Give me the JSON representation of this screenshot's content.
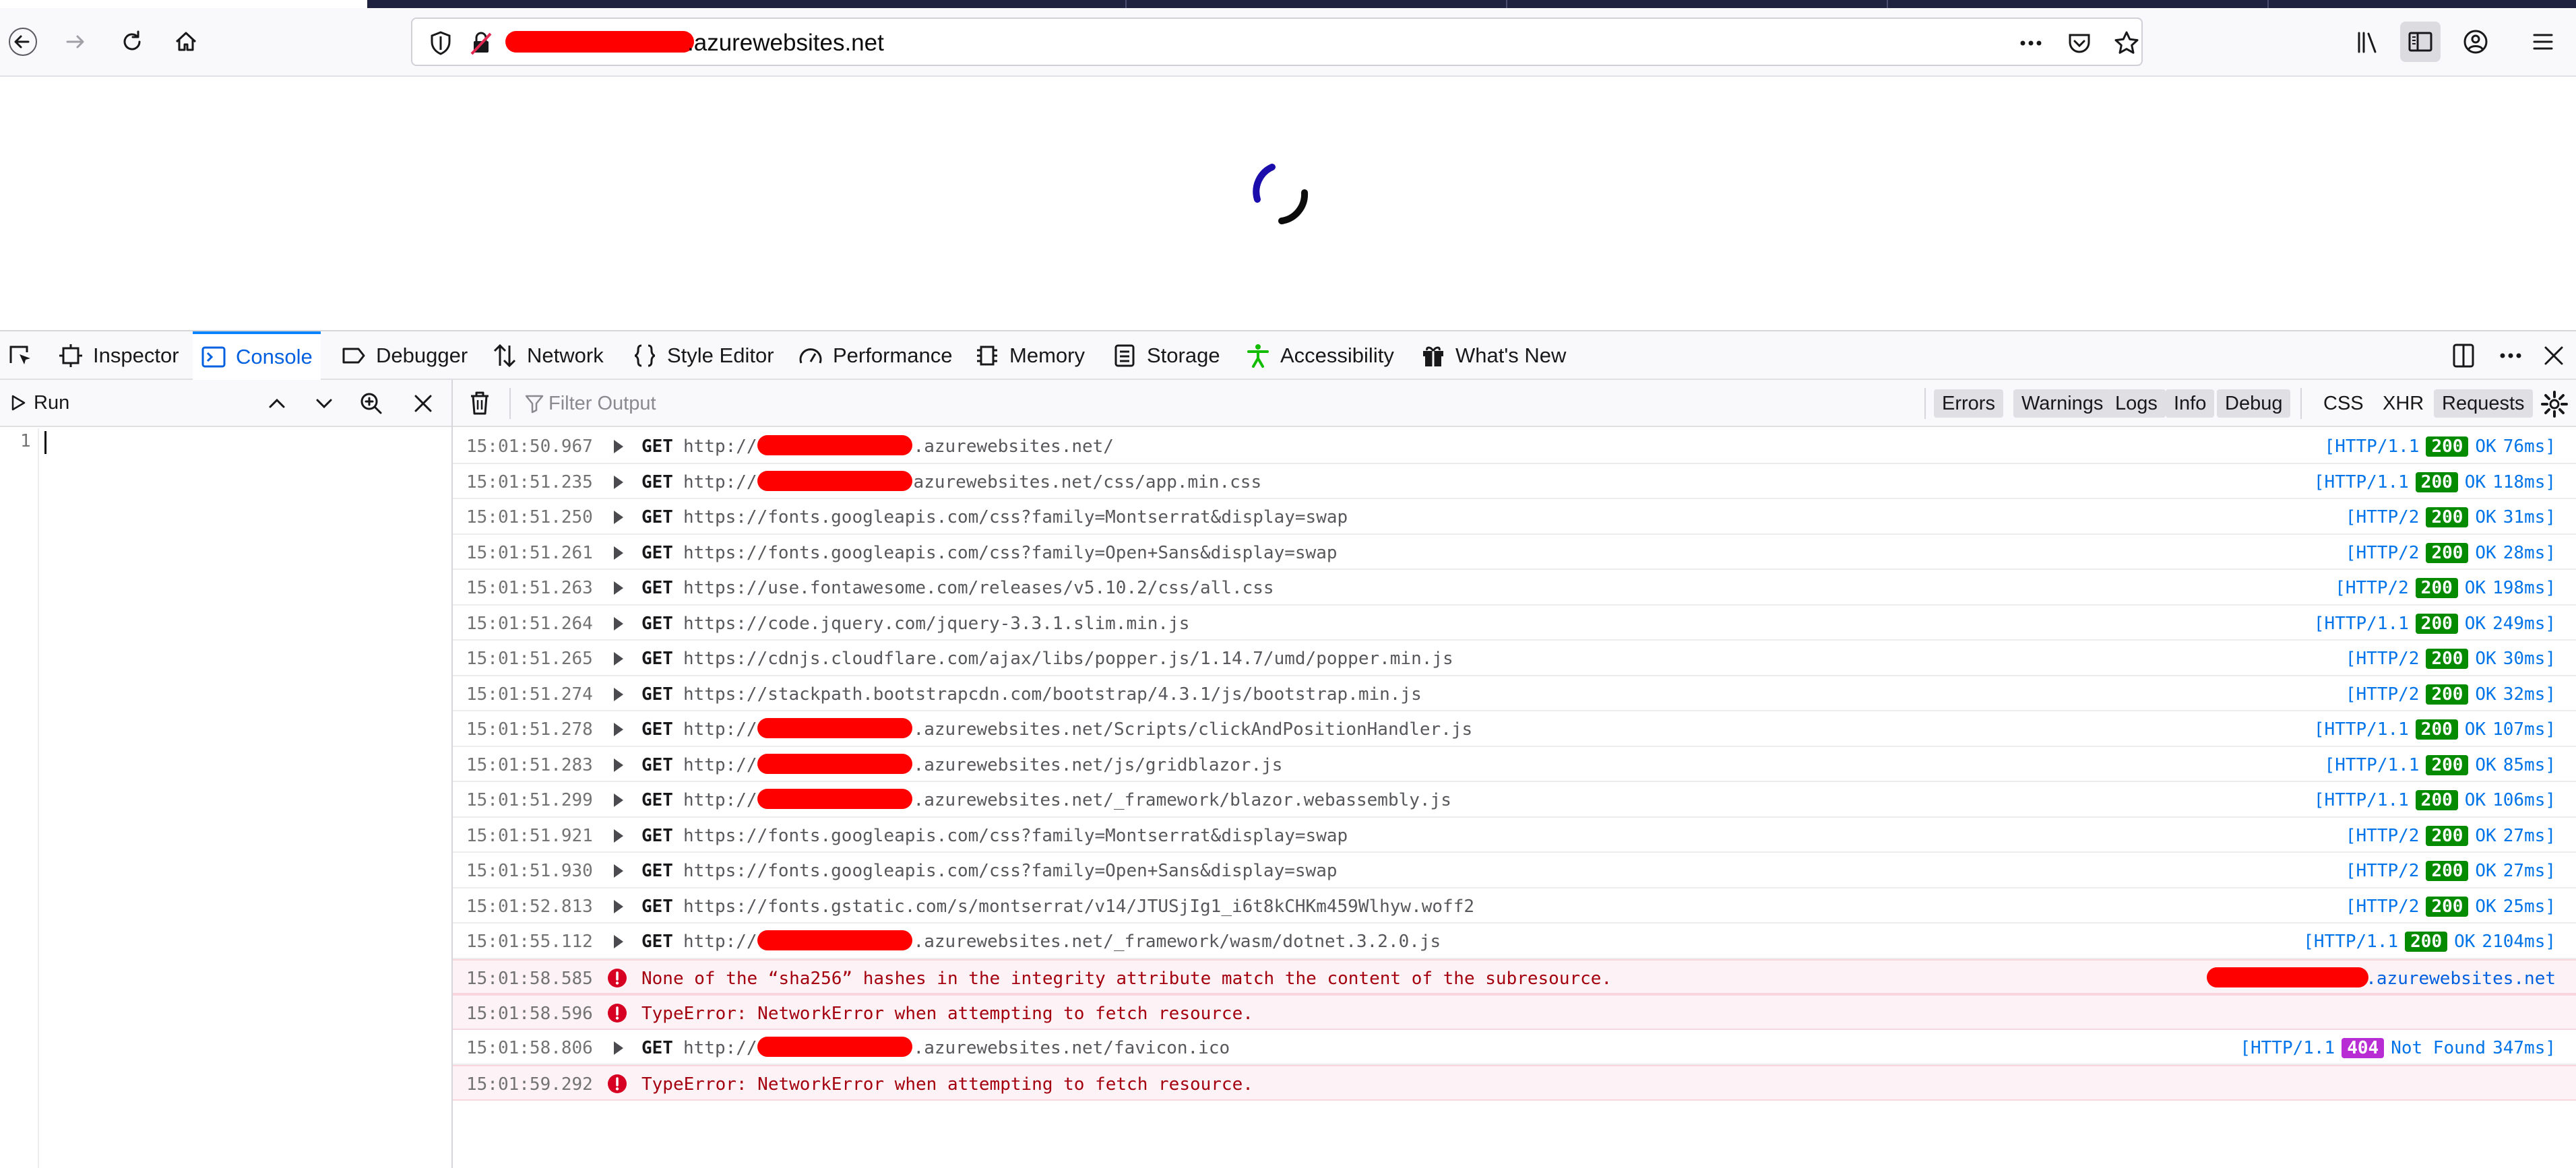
{
  "browser": {
    "url_visible": ".azurewebsites.net",
    "nav": {
      "back_icon": "arrow-left-icon",
      "forward_icon": "arrow-right-icon",
      "reload_icon": "reload-icon",
      "home_icon": "home-icon"
    }
  },
  "devtools": {
    "tabs": [
      {
        "label": "Inspector"
      },
      {
        "label": "Console",
        "selected": true
      },
      {
        "label": "Debugger"
      },
      {
        "label": "Network"
      },
      {
        "label": "Style Editor"
      },
      {
        "label": "Performance"
      },
      {
        "label": "Memory"
      },
      {
        "label": "Storage"
      },
      {
        "label": "Accessibility"
      },
      {
        "label": "What's New"
      }
    ],
    "editor": {
      "run_label": "Run",
      "line_number": "1"
    },
    "console": {
      "filter_placeholder": "Filter Output",
      "filters": [
        "Errors",
        "Warnings",
        "Logs",
        "Info",
        "Debug",
        "CSS",
        "XHR",
        "Requests"
      ],
      "active_filters": [
        "Errors",
        "Warnings",
        "Logs",
        "Info",
        "Debug",
        "Requests"
      ],
      "rows": [
        {
          "type": "request",
          "time": "15:01:50.967",
          "method": "GET",
          "url_prefix": "http://",
          "url": ".azurewebsites.net/",
          "redact": true,
          "protocol": "[HTTP/1.1",
          "status": "200",
          "status_text": "OK",
          "duration": "76ms]"
        },
        {
          "type": "request",
          "time": "15:01:51.235",
          "method": "GET",
          "url_prefix": "http://",
          "url": "azurewebsites.net/css/app.min.css",
          "redact": true,
          "protocol": "[HTTP/1.1",
          "status": "200",
          "status_text": "OK",
          "duration": "118ms]"
        },
        {
          "type": "request",
          "time": "15:01:51.250",
          "method": "GET",
          "url_prefix": "",
          "url": "https://fonts.googleapis.com/css?family=Montserrat&display=swap",
          "redact": false,
          "protocol": "[HTTP/2",
          "status": "200",
          "status_text": "OK",
          "duration": "31ms]"
        },
        {
          "type": "request",
          "time": "15:01:51.261",
          "method": "GET",
          "url_prefix": "",
          "url": "https://fonts.googleapis.com/css?family=Open+Sans&display=swap",
          "redact": false,
          "protocol": "[HTTP/2",
          "status": "200",
          "status_text": "OK",
          "duration": "28ms]"
        },
        {
          "type": "request",
          "time": "15:01:51.263",
          "method": "GET",
          "url_prefix": "",
          "url": "https://use.fontawesome.com/releases/v5.10.2/css/all.css",
          "redact": false,
          "protocol": "[HTTP/2",
          "status": "200",
          "status_text": "OK",
          "duration": "198ms]"
        },
        {
          "type": "request",
          "time": "15:01:51.264",
          "method": "GET",
          "url_prefix": "",
          "url": "https://code.jquery.com/jquery-3.3.1.slim.min.js",
          "redact": false,
          "protocol": "[HTTP/1.1",
          "status": "200",
          "status_text": "OK",
          "duration": "249ms]"
        },
        {
          "type": "request",
          "time": "15:01:51.265",
          "method": "GET",
          "url_prefix": "",
          "url": "https://cdnjs.cloudflare.com/ajax/libs/popper.js/1.14.7/umd/popper.min.js",
          "redact": false,
          "protocol": "[HTTP/2",
          "status": "200",
          "status_text": "OK",
          "duration": "30ms]"
        },
        {
          "type": "request",
          "time": "15:01:51.274",
          "method": "GET",
          "url_prefix": "",
          "url": "https://stackpath.bootstrapcdn.com/bootstrap/4.3.1/js/bootstrap.min.js",
          "redact": false,
          "protocol": "[HTTP/2",
          "status": "200",
          "status_text": "OK",
          "duration": "32ms]"
        },
        {
          "type": "request",
          "time": "15:01:51.278",
          "method": "GET",
          "url_prefix": "http://",
          "url": ".azurewebsites.net/Scripts/clickAndPositionHandler.js",
          "redact": true,
          "protocol": "[HTTP/1.1",
          "status": "200",
          "status_text": "OK",
          "duration": "107ms]"
        },
        {
          "type": "request",
          "time": "15:01:51.283",
          "method": "GET",
          "url_prefix": "http://",
          "url": ".azurewebsites.net/js/gridblazor.js",
          "redact": true,
          "protocol": "[HTTP/1.1",
          "status": "200",
          "status_text": "OK",
          "duration": "85ms]"
        },
        {
          "type": "request",
          "time": "15:01:51.299",
          "method": "GET",
          "url_prefix": "http://",
          "url": ".azurewebsites.net/_framework/blazor.webassembly.js",
          "redact": true,
          "protocol": "[HTTP/1.1",
          "status": "200",
          "status_text": "OK",
          "duration": "106ms]"
        },
        {
          "type": "request",
          "time": "15:01:51.921",
          "method": "GET",
          "url_prefix": "",
          "url": "https://fonts.googleapis.com/css?family=Montserrat&display=swap",
          "redact": false,
          "protocol": "[HTTP/2",
          "status": "200",
          "status_text": "OK",
          "duration": "27ms]"
        },
        {
          "type": "request",
          "time": "15:01:51.930",
          "method": "GET",
          "url_prefix": "",
          "url": "https://fonts.googleapis.com/css?family=Open+Sans&display=swap",
          "redact": false,
          "protocol": "[HTTP/2",
          "status": "200",
          "status_text": "OK",
          "duration": "27ms]"
        },
        {
          "type": "request",
          "time": "15:01:52.813",
          "method": "GET",
          "url_prefix": "",
          "url": "https://fonts.gstatic.com/s/montserrat/v14/JTUSjIg1_i6t8kCHKm459Wlhyw.woff2",
          "redact": false,
          "protocol": "[HTTP/2",
          "status": "200",
          "status_text": "OK",
          "duration": "25ms]"
        },
        {
          "type": "request",
          "time": "15:01:55.112",
          "method": "GET",
          "url_prefix": "http://",
          "url": ".azurewebsites.net/_framework/wasm/dotnet.3.2.0.js",
          "redact": true,
          "protocol": "[HTTP/1.1",
          "status": "200",
          "status_text": "OK",
          "duration": "2104ms]"
        },
        {
          "type": "error",
          "time": "15:01:58.585",
          "message": "None of the “sha256” hashes in the integrity attribute match the content of the subresource.",
          "source": ".azurewebsites.net"
        },
        {
          "type": "error",
          "time": "15:01:58.596",
          "message": "TypeError: NetworkError when attempting to fetch resource.",
          "source": ""
        },
        {
          "type": "request",
          "time": "15:01:58.806",
          "method": "GET",
          "url_prefix": "http://",
          "url": ".azurewebsites.net/favicon.ico",
          "redact": true,
          "protocol": "[HTTP/1.1",
          "status": "404",
          "status_text": "Not Found",
          "duration": "347ms]"
        },
        {
          "type": "error",
          "time": "15:01:59.292",
          "message": "TypeError: NetworkError when attempting to fetch resource.",
          "source": ""
        }
      ]
    }
  }
}
